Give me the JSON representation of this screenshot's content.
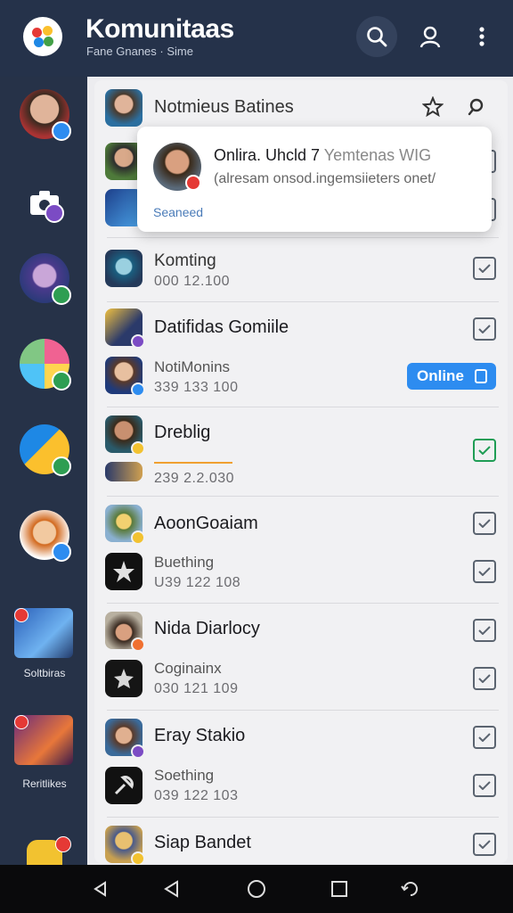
{
  "header": {
    "title": "Komunitaas",
    "subtitle": "Fane Gnanes · Sime",
    "icons": [
      "app-logo-icon",
      "search-icon",
      "user-icon",
      "more-vertical-icon"
    ]
  },
  "sidebar": {
    "label_1": "Soltbiras",
    "label_2": "Reritlikes"
  },
  "list": {
    "header_name": "Notmieus Batines",
    "rows": [
      {
        "name": "Komting",
        "number": "000 12.100"
      },
      {
        "name": "Datifidas Gomiile"
      },
      {
        "name": "NotiMonins",
        "number": "339 133 100"
      },
      {
        "name": "Dreblig",
        "number": "239 2.2.030"
      },
      {
        "name": "AoonGoaiam"
      },
      {
        "name": "Buething",
        "number": "U39 122 108"
      },
      {
        "name": "Nida Diarlocy"
      },
      {
        "name": "Coginainx",
        "number": "030 121 109"
      },
      {
        "name": "Eray Stakio"
      },
      {
        "name": "Soething",
        "number": "039 122 103"
      },
      {
        "name": "Siap Bandet"
      }
    ]
  },
  "popup": {
    "title": "Onlira. Uhcld 7",
    "title_extra": "Yemtenas WIG",
    "description": "(alresam onsod.ingemsiieters onet/",
    "search_label": "Seaneed"
  },
  "online_badge": "Online",
  "colors": {
    "header_bg": "#25324a",
    "sidebar_bg": "#263248",
    "online": "#2d8cf0",
    "check_green": "#1f9d55"
  }
}
